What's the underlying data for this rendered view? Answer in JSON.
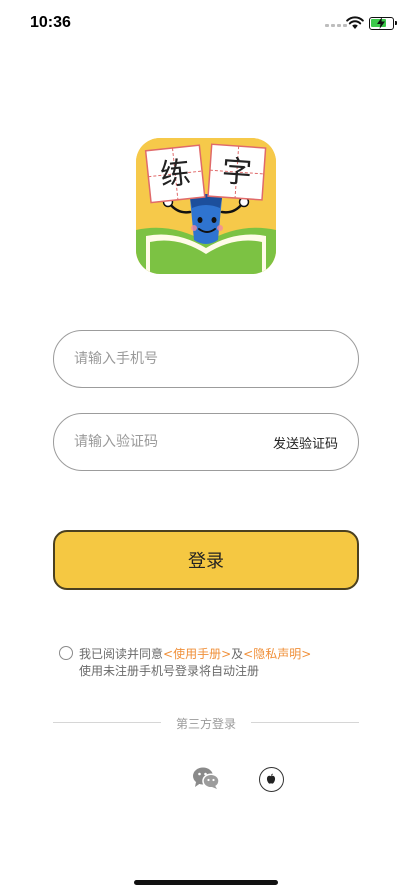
{
  "status_bar": {
    "time": "10:36"
  },
  "logo": {
    "char_left": "练",
    "char_right": "字"
  },
  "form": {
    "phone_placeholder": "请输入手机号",
    "code_placeholder": "请输入验证码",
    "send_code_label": "发送验证码",
    "login_label": "登录"
  },
  "agreement": {
    "prefix": "我已阅读并同意",
    "manual_link": "<使用手册>",
    "and": "及",
    "privacy_link": "<隐私声明>",
    "note": "使用未注册手机号登录将自动注册"
  },
  "third_party": {
    "label": "第三方登录"
  },
  "colors": {
    "accent": "#f5c842",
    "link": "#f0903a",
    "logo_green": "#7cc243"
  }
}
